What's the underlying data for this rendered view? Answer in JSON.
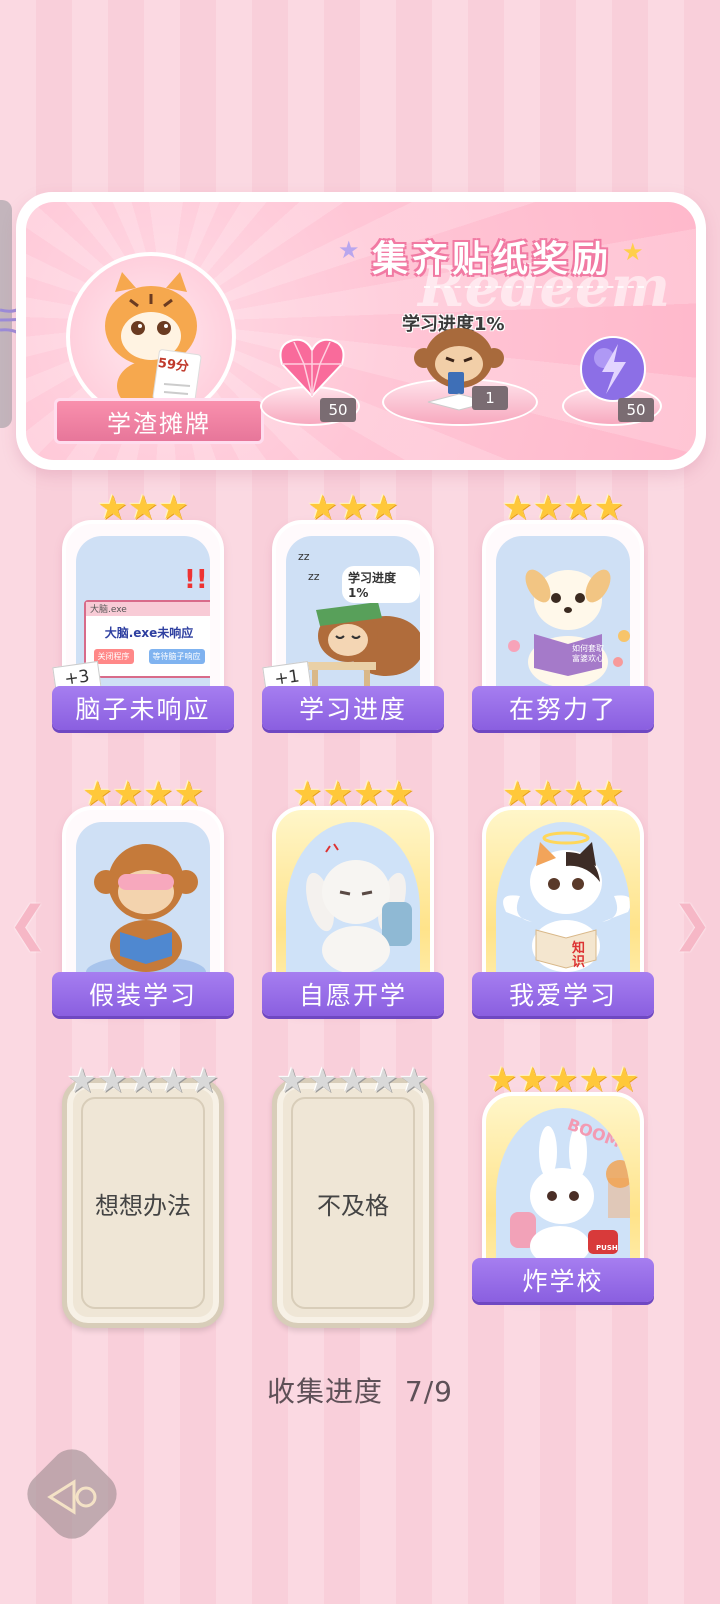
{
  "panel": {
    "title": "集齐贴纸奖励",
    "watermark": "Redeem",
    "tiger_label": "学渣摊牌",
    "tiger_paper": "59分",
    "progress_label": "学习进度1%",
    "rewards": [
      {
        "icon": "pink-heart-gem-icon",
        "count": "50"
      },
      {
        "icon": "monkey-reading-sticker",
        "count": "1"
      },
      {
        "icon": "purple-lightning-orb-icon",
        "count": "50"
      }
    ]
  },
  "cards": [
    {
      "label": "脑子未响应",
      "stars": 3,
      "bonus": "+3",
      "art": "brain-not-responding-dialog",
      "dialog": {
        "title": "大脑.exe",
        "message": "大脑.exe未响应",
        "btn1": "关闭程序",
        "btn2": "等待脑子响应"
      }
    },
    {
      "label": "学习进度",
      "stars": 3,
      "bonus": "+1",
      "art": "sleeping-sloth-books",
      "bubble": "学习进度1%"
    },
    {
      "label": "在努力了",
      "stars": 4,
      "art": "puppy-reading-book",
      "book_text": "如何套取富婆欢心"
    },
    {
      "label": "假装学习",
      "stars": 4,
      "art": "monkey-sleep-mask-reading"
    },
    {
      "label": "自愿开学",
      "stars": 4,
      "art": "grumpy-bunny-backpack",
      "gold": true
    },
    {
      "label": "我爱学习",
      "stars": 4,
      "art": "angel-cat-reading",
      "gold": true,
      "book_text": "知识"
    },
    {
      "label": "想想办法",
      "stars": 5,
      "locked": true
    },
    {
      "label": "不及格",
      "stars": 5,
      "locked": true
    },
    {
      "label": "炸学校",
      "stars": 5,
      "art": "bunny-detonator",
      "gold": true,
      "boom": "BOOM!!",
      "push": "PUSH"
    }
  ],
  "collection": {
    "label": "收集进度",
    "value": "7/9"
  },
  "colors": {
    "accent_purple": "#8a5fe0",
    "pink": "#f17aa3",
    "gold": "#ffc83a"
  }
}
